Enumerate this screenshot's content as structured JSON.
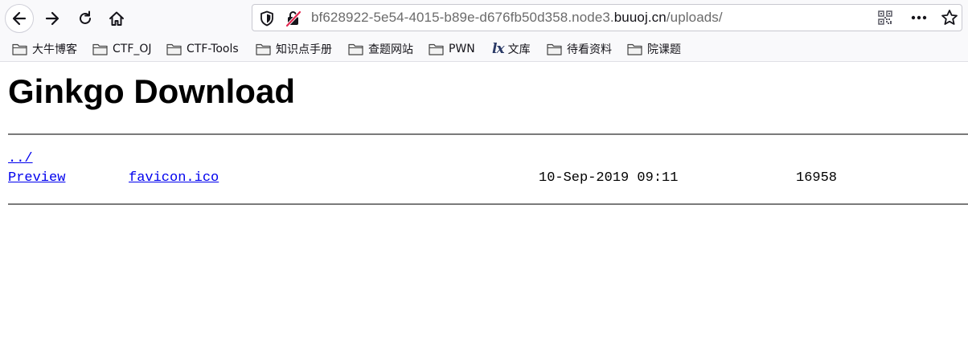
{
  "browser": {
    "url": {
      "prefix": "bf628922-5e54-4015-b89e-d676fb50d358.node3.",
      "domain": "buuoj.cn",
      "path": "/uploads/"
    },
    "icons": {
      "back": "back-arrow-icon",
      "forward": "forward-arrow-icon",
      "reload": "reload-icon",
      "home": "home-icon",
      "tracking": "shield-icon",
      "insecure": "insecure-lock-icon",
      "qr": "qr-code-icon",
      "more": "more-actions-icon",
      "bookmark": "star-icon"
    },
    "bookmarks": [
      {
        "label": "大牛博客",
        "icon": "folder-icon"
      },
      {
        "label": "CTF_OJ",
        "icon": "folder-icon"
      },
      {
        "label": "CTF-Tools",
        "icon": "folder-icon"
      },
      {
        "label": "知识点手册",
        "icon": "folder-icon"
      },
      {
        "label": "查题网站",
        "icon": "folder-icon"
      },
      {
        "label": "PWN",
        "icon": "folder-icon"
      },
      {
        "label": "文库",
        "icon": "lx-icon",
        "icon_text": "lx"
      },
      {
        "label": "待看资料",
        "icon": "folder-icon"
      },
      {
        "label": "院课题",
        "icon": "folder-icon"
      }
    ]
  },
  "page": {
    "title": "Ginkgo Download",
    "parent_link": "../",
    "files": [
      {
        "preview": "Preview",
        "name": "favicon.ico",
        "date": "10-Sep-2019 09:11",
        "size": "16958"
      }
    ]
  },
  "colors": {
    "link": "#0000ee",
    "insecure_accent": "#e22850"
  }
}
